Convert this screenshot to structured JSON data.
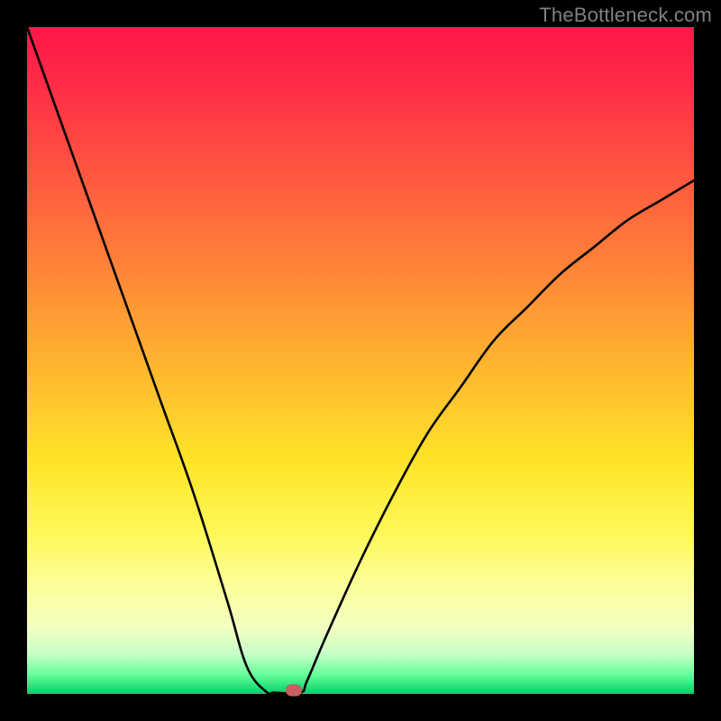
{
  "watermark": "TheBottleneck.com",
  "chart_data": {
    "type": "line",
    "title": "",
    "xlabel": "",
    "ylabel": "",
    "xlim": [
      0,
      1
    ],
    "ylim": [
      0,
      1
    ],
    "legend": false,
    "grid": false,
    "background_gradient": {
      "direction": "vertical",
      "top_color": "#ff1648",
      "bottom_color": "#1cc46a",
      "meaning": "top = high bottleneck (bad), bottom = low bottleneck (good)"
    },
    "series": [
      {
        "name": "bottleneck-curve",
        "description": "V-shaped curve; y is bottleneck level (1=worst at top, 0=best at bottom), x is relative hardware balance.",
        "x": [
          0.0,
          0.05,
          0.1,
          0.15,
          0.2,
          0.25,
          0.3,
          0.33,
          0.36,
          0.37,
          0.41,
          0.42,
          0.45,
          0.5,
          0.55,
          0.6,
          0.65,
          0.7,
          0.75,
          0.8,
          0.85,
          0.9,
          0.95,
          1.0
        ],
        "y": [
          1.0,
          0.86,
          0.72,
          0.58,
          0.44,
          0.3,
          0.14,
          0.04,
          0.0,
          0.0,
          0.0,
          0.02,
          0.09,
          0.2,
          0.3,
          0.39,
          0.46,
          0.53,
          0.58,
          0.63,
          0.67,
          0.71,
          0.74,
          0.77
        ]
      }
    ],
    "marker": {
      "name": "optimal-point",
      "x": 0.4,
      "y": 0.0,
      "color": "#c65f5d"
    }
  }
}
